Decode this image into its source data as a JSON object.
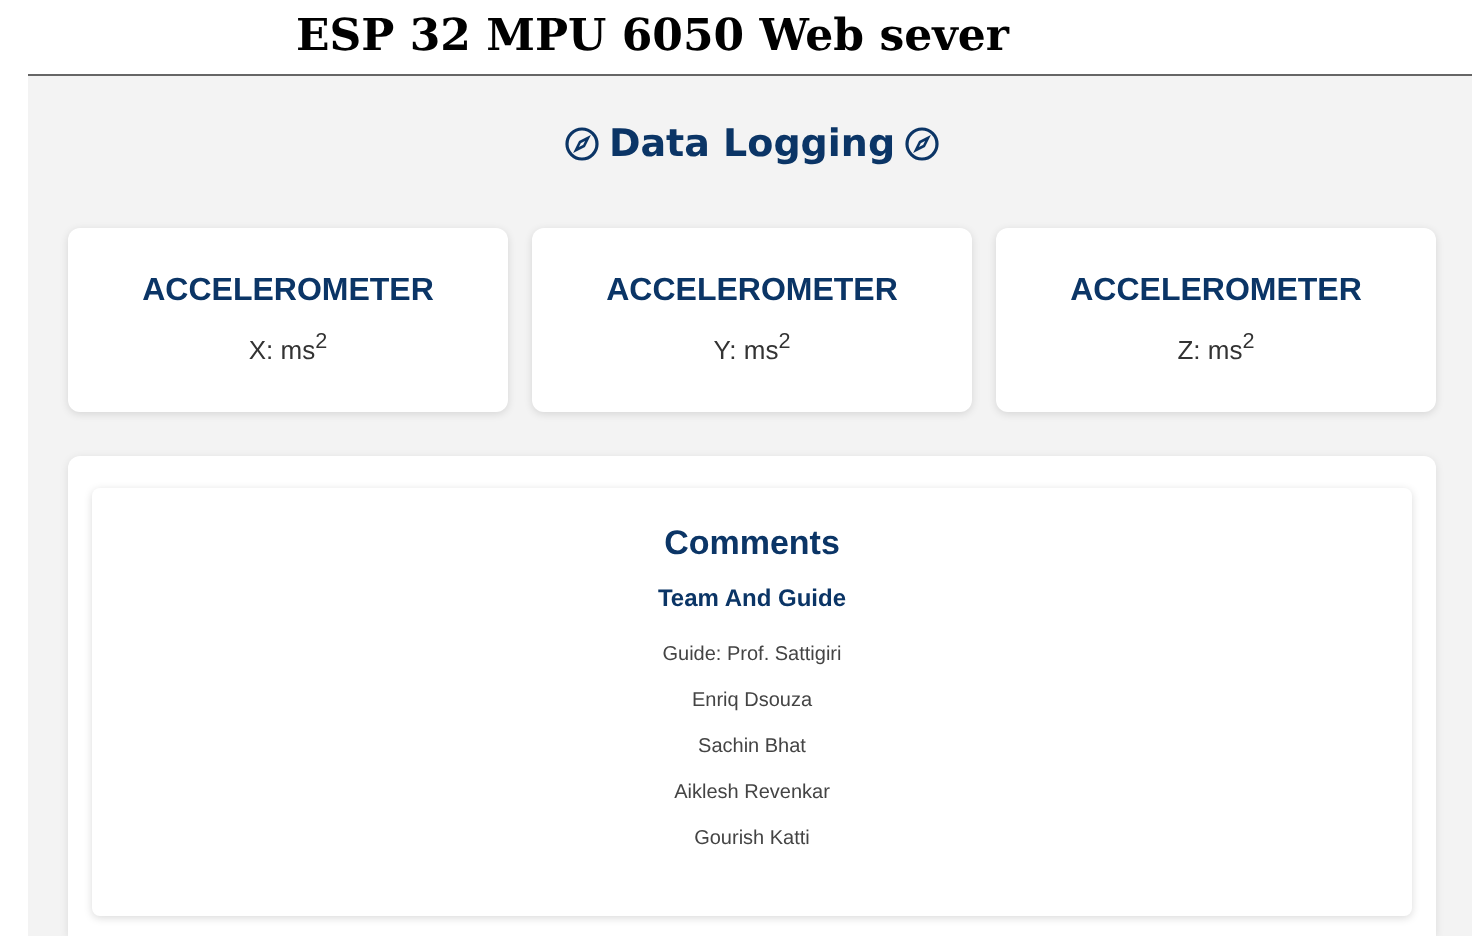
{
  "page_title": "ESP 32 MPU 6050 Web sever",
  "header": {
    "title": "Data Logging"
  },
  "cards": [
    {
      "title": "ACCELEROMETER",
      "reading": "X: ms$^{2}$"
    },
    {
      "title": "ACCELEROMETER",
      "reading": "Y: ms$^{2}$"
    },
    {
      "title": "ACCELEROMETER",
      "reading": "Z: ms$^{2}$"
    }
  ],
  "comments": {
    "title": "Comments",
    "subtitle": "Team And Guide",
    "lines": [
      "Guide: Prof. Sattigiri",
      "Enriq Dsouza",
      "Sachin Bhat",
      "Aiklesh Revenkar",
      "Gourish Katti"
    ]
  }
}
